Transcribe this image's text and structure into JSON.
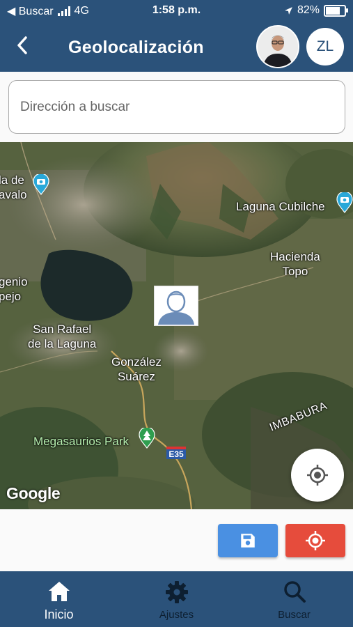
{
  "status_bar": {
    "back_app": "◀ Buscar",
    "network": "4G",
    "time": "1:58 p.m.",
    "battery": "82%",
    "battery_level": 0.82
  },
  "app_bar": {
    "title": "Geolocalización",
    "user_initials": "ZL",
    "back_icon": "chevron-left-icon"
  },
  "search": {
    "placeholder": "Dirección a buscar",
    "value": ""
  },
  "map": {
    "labels": {
      "otavalo": "la de\navalo",
      "laguna_cubilche": "Laguna Cubilche",
      "hacienda_topo": "Hacienda\nTopo",
      "ingenio": "genio\npejo",
      "san_rafael": "San Rafael\nde la Laguna",
      "gonzalez_suarez": "González\nSuárez",
      "megasaurios": "Megasaurios Park",
      "imbabura": "IMBABURA",
      "highway": "E35"
    },
    "attribution": "Google"
  },
  "actions": {
    "save_icon": "save-icon",
    "gps_icon": "gps-icon"
  },
  "bottom_nav": {
    "items": [
      {
        "label": "Inicio",
        "icon": "home-icon",
        "active": true
      },
      {
        "label": "Ajustes",
        "icon": "gear-icon",
        "active": false
      },
      {
        "label": "Buscar",
        "icon": "search-icon",
        "active": false
      }
    ]
  },
  "colors": {
    "primary": "#2b527a",
    "save_button": "#4a90e2",
    "gps_button": "#e64c3c"
  }
}
